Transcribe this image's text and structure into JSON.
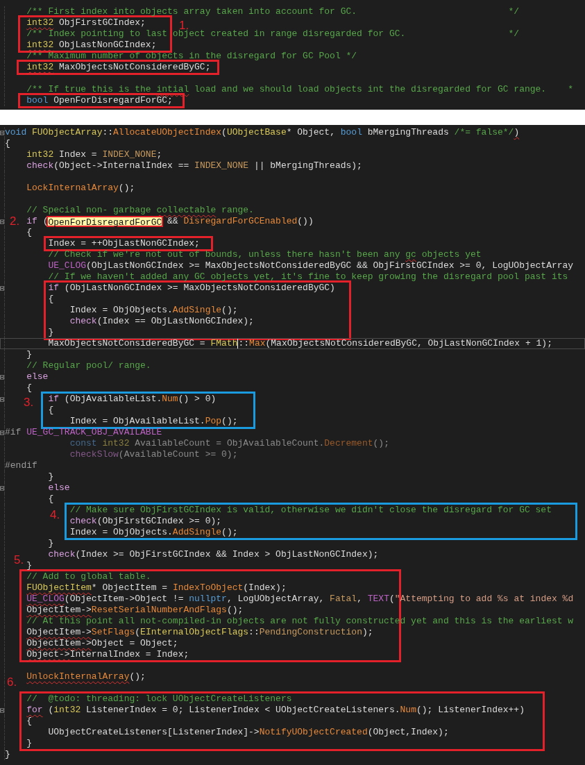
{
  "panels": [
    {
      "lines": [
        {
          "kind": "line",
          "fold": false,
          "tokens": [
            {
              "kind": "comment",
              "t": "    /** First index into objects array taken into account for GC.                            */"
            }
          ]
        },
        {
          "kind": "box",
          "color": "#e3212b",
          "label": "1.",
          "lines": [
            {
              "kind": "line",
              "fold": false,
              "tokens": [
                {
                  "kind": "type",
                  "t": "    int32",
                  "squiggle": true
                },
                {
                  "kind": "text",
                  "t": " ObjFirstGCIndex;"
                }
              ]
            },
            {
              "kind": "line",
              "fold": false,
              "tokens": [
                {
                  "kind": "comment",
                  "t": "    /** Index pointing to last object created in range disregarded for GC.                   */"
                }
              ]
            },
            {
              "kind": "line",
              "fold": false,
              "tokens": [
                {
                  "kind": "type",
                  "t": "    int32",
                  "squiggle": true
                },
                {
                  "kind": "text",
                  "t": " ObjLastNonGCIndex;"
                }
              ]
            }
          ]
        },
        {
          "kind": "line",
          "fold": false,
          "tokens": [
            {
              "kind": "comment",
              "t": "    /** Maximum number of objects in the disregard for GC Pool */"
            }
          ]
        },
        {
          "kind": "box",
          "color": "#e3212b",
          "lines": [
            {
              "kind": "line",
              "fold": false,
              "tokens": [
                {
                  "kind": "type",
                  "t": "    int32",
                  "squiggle": true
                },
                {
                  "kind": "text",
                  "t": " MaxObjectsNotConsideredByGC;"
                }
              ]
            }
          ]
        },
        {
          "kind": "line",
          "fold": false
        },
        {
          "kind": "line",
          "fold": false,
          "tokens": [
            {
              "kind": "comment",
              "t": "    /** If true this is the "
            },
            {
              "kind": "comment",
              "t": "intial",
              "squiggle": true
            },
            {
              "kind": "comment",
              "t": " load and we should load objects int the disregarded for GC range.    *"
            }
          ]
        },
        {
          "kind": "box",
          "color": "#e3212b",
          "lines": [
            {
              "kind": "line",
              "fold": false,
              "tokens": [
                {
                  "kind": "keyword",
                  "t": "    bool"
                },
                {
                  "kind": "text",
                  "t": " OpenForDisregardForGC;"
                }
              ]
            }
          ]
        }
      ]
    },
    {
      "lines": [
        {
          "kind": "line",
          "fold": true,
          "tokens": [
            {
              "kind": "keyword",
              "t": "void "
            },
            {
              "kind": "type",
              "t": "FUObjectArray"
            },
            {
              "kind": "text",
              "t": "::"
            },
            {
              "kind": "function",
              "t": "AllocateUObjectIndex"
            },
            {
              "kind": "text",
              "t": "("
            },
            {
              "kind": "type",
              "t": "UObjectBase"
            },
            {
              "kind": "text",
              "t": "* Object, "
            },
            {
              "kind": "keyword",
              "t": "bool"
            },
            {
              "kind": "text",
              "t": " bMergingThreads "
            },
            {
              "kind": "comment",
              "t": "/*= false*/"
            },
            {
              "kind": "text",
              "t": ")",
              "squiggle": true
            }
          ]
        },
        {
          "kind": "line",
          "fold": false,
          "tokens": [
            {
              "kind": "text",
              "t": "{"
            }
          ]
        },
        {
          "kind": "line",
          "fold": false,
          "tokens": [
            {
              "kind": "type",
              "t": "    int32"
            },
            {
              "kind": "text",
              "t": " Index = "
            },
            {
              "kind": "constant",
              "t": "INDEX_NONE"
            },
            {
              "kind": "text",
              "t": ";"
            }
          ]
        },
        {
          "kind": "line",
          "fold": false,
          "tokens": [
            {
              "kind": "control",
              "t": "    check"
            },
            {
              "kind": "text",
              "t": "(Object->InternalIndex == "
            },
            {
              "kind": "constant",
              "t": "INDEX_NONE"
            },
            {
              "kind": "text",
              "t": " || bMergingThreads);"
            }
          ]
        },
        {
          "kind": "line",
          "fold": false
        },
        {
          "kind": "line",
          "fold": false,
          "tokens": [
            {
              "kind": "function",
              "t": "    LockInternalArray"
            },
            {
              "kind": "text",
              "t": "();"
            }
          ]
        },
        {
          "kind": "line",
          "fold": false
        },
        {
          "kind": "line",
          "fold": false,
          "tokens": [
            {
              "kind": "comment",
              "t": "    // Special non- garbage "
            },
            {
              "kind": "comment",
              "t": "collectable",
              "squiggle": true
            },
            {
              "kind": "comment",
              "t": " range."
            }
          ]
        },
        {
          "kind": "line",
          "fold": true,
          "tokens": [
            {
              "kind": "control",
              "t": "    if"
            },
            {
              "kind": "text",
              "t": " ("
            },
            {
              "kind": "text",
              "t": "OpenForDisregardForGC",
              "highlighted": true,
              "color": "#e3212b",
              "label": "2."
            },
            {
              "kind": "text",
              "t": " && "
            },
            {
              "kind": "function",
              "t": "DisregardForGCEnabled"
            },
            {
              "kind": "text",
              "t": "())"
            }
          ]
        },
        {
          "kind": "line",
          "fold": false,
          "tokens": [
            {
              "kind": "text",
              "t": "    {"
            }
          ]
        },
        {
          "kind": "box",
          "color": "#e3212b",
          "lines": [
            {
              "kind": "line",
              "fold": false,
              "tokens": [
                {
                  "kind": "text",
                  "t": "        Index = ++ObjLastNonGCIndex;"
                }
              ]
            }
          ]
        },
        {
          "kind": "line",
          "fold": false,
          "tokens": [
            {
              "kind": "comment",
              "t": "        // Check if we're not out of bounds, unless there hasn't been any "
            },
            {
              "kind": "comment",
              "t": "gc",
              "squiggle": true
            },
            {
              "kind": "comment",
              "t": " objects yet"
            }
          ]
        },
        {
          "kind": "line",
          "fold": false,
          "tokens": [
            {
              "kind": "macro",
              "t": "        UE_CLOG"
            },
            {
              "kind": "text",
              "t": "(ObjLastNonGCIndex >= MaxObjectsNotConsideredByGC && ObjFirstGCIndex >= 0, LogUObjectArray"
            }
          ]
        },
        {
          "kind": "line",
          "fold": false,
          "tokens": [
            {
              "kind": "comment",
              "t": "        // If we haven't added any GC objects yet, it's fine to keep growing the disregard pool past its"
            }
          ]
        },
        {
          "kind": "box",
          "color": "#e3212b",
          "lines": [
            {
              "kind": "line",
              "fold": true,
              "tokens": [
                {
                  "kind": "control",
                  "t": "        if"
                },
                {
                  "kind": "text",
                  "t": " (ObjLastNonGCIndex >= MaxObjectsNotConsideredByGC)"
                }
              ]
            },
            {
              "kind": "line",
              "fold": false,
              "tokens": [
                {
                  "kind": "text",
                  "t": "        {"
                }
              ]
            },
            {
              "kind": "line",
              "fold": false,
              "tokens": [
                {
                  "kind": "text",
                  "t": "            Index = ObjObjects."
                },
                {
                  "kind": "function",
                  "t": "AddSingle"
                },
                {
                  "kind": "text",
                  "t": "();"
                }
              ]
            },
            {
              "kind": "line",
              "fold": false,
              "tokens": [
                {
                  "kind": "control",
                  "t": "            check"
                },
                {
                  "kind": "text",
                  "t": "(Index == ObjLastNonGCIndex);"
                }
              ]
            },
            {
              "kind": "line",
              "fold": false,
              "tokens": [
                {
                  "kind": "text",
                  "t": "        }"
                }
              ]
            }
          ]
        },
        {
          "kind": "line",
          "fold": false,
          "current": true,
          "tokens": [
            {
              "kind": "text",
              "t": "        MaxObjectsNotConsideredByGC = "
            },
            {
              "kind": "type",
              "t": "FMath"
            },
            {
              "kind": "text",
              "t": "::",
              "caret_before": true
            },
            {
              "kind": "function",
              "t": "Max"
            },
            {
              "kind": "text",
              "t": "(MaxObjectsNotConsideredByGC, ObjLastNonGCIndex + 1);"
            }
          ]
        },
        {
          "kind": "line",
          "fold": false,
          "tokens": [
            {
              "kind": "text",
              "t": "    }"
            }
          ]
        },
        {
          "kind": "line",
          "fold": false,
          "tokens": [
            {
              "kind": "comment",
              "t": "    // Regular pool/ range."
            }
          ]
        },
        {
          "kind": "line",
          "fold": true,
          "tokens": [
            {
              "kind": "control",
              "t": "    else"
            }
          ]
        },
        {
          "kind": "line",
          "fold": false,
          "tokens": [
            {
              "kind": "text",
              "t": "    {"
            }
          ]
        },
        {
          "kind": "box",
          "color": "#1a9be0",
          "label": "3.",
          "lines": [
            {
              "kind": "line",
              "fold": true,
              "tokens": [
                {
                  "kind": "control",
                  "t": "        if"
                },
                {
                  "kind": "text",
                  "t": " (ObjAvailableList."
                },
                {
                  "kind": "function",
                  "t": "Num"
                },
                {
                  "kind": "text",
                  "t": "() > 0)"
                }
              ]
            },
            {
              "kind": "line",
              "fold": false,
              "tokens": [
                {
                  "kind": "text",
                  "t": "        {"
                }
              ]
            },
            {
              "kind": "line",
              "fold": false,
              "tokens": [
                {
                  "kind": "text",
                  "t": "            Index = ObjAvailableList."
                },
                {
                  "kind": "function",
                  "t": "Pop"
                },
                {
                  "kind": "text",
                  "t": "();"
                }
              ]
            }
          ]
        },
        {
          "kind": "line",
          "fold": true,
          "tokens": [
            {
              "kind": "preprocessor",
              "t": "#if "
            },
            {
              "kind": "macro",
              "t": "UE_GC_TRACK_OBJ_AVAILABLE"
            }
          ]
        },
        {
          "kind": "line",
          "fold": false,
          "tokens": [
            {
              "kind": "dim_keyword",
              "t": "            const "
            },
            {
              "kind": "dim_type",
              "t": "int32"
            },
            {
              "kind": "dim_text",
              "t": " AvailableCount = ObjAvailableCount."
            },
            {
              "kind": "dim_function",
              "t": "Decrement"
            },
            {
              "kind": "dim_text",
              "t": "();"
            }
          ]
        },
        {
          "kind": "line",
          "fold": false,
          "tokens": [
            {
              "kind": "dim_control",
              "t": "            checkSlow"
            },
            {
              "kind": "dim_text",
              "t": "(AvailableCount >= 0);"
            }
          ]
        },
        {
          "kind": "line",
          "fold": false,
          "tokens": [
            {
              "kind": "preprocessor",
              "t": "#endif"
            }
          ]
        },
        {
          "kind": "line",
          "fold": false,
          "tokens": [
            {
              "kind": "text",
              "t": "        }"
            }
          ]
        },
        {
          "kind": "line",
          "fold": true,
          "tokens": [
            {
              "kind": "control",
              "t": "        else"
            }
          ]
        },
        {
          "kind": "line",
          "fold": false,
          "tokens": [
            {
              "kind": "text",
              "t": "        {"
            }
          ]
        },
        {
          "kind": "box",
          "color": "#1a9be0",
          "label": "4.",
          "lines": [
            {
              "kind": "line",
              "fold": false,
              "tokens": [
                {
                  "kind": "comment",
                  "t": "            // Make sure ObjFirstGCIndex is valid, otherwise we didn't close the disregard for GC set"
                }
              ]
            },
            {
              "kind": "line",
              "fold": false,
              "tokens": [
                {
                  "kind": "control",
                  "t": "            check"
                },
                {
                  "kind": "text",
                  "t": "(ObjFirstGCIndex >= 0);"
                }
              ]
            },
            {
              "kind": "line",
              "fold": false,
              "tokens": [
                {
                  "kind": "text",
                  "t": "            Index = ObjObjects."
                },
                {
                  "kind": "function",
                  "t": "AddSingle"
                },
                {
                  "kind": "text",
                  "t": "();"
                }
              ]
            }
          ]
        },
        {
          "kind": "line",
          "fold": false,
          "tokens": [
            {
              "kind": "text",
              "t": "        }"
            }
          ]
        },
        {
          "kind": "line",
          "fold": false,
          "tokens": [
            {
              "kind": "control",
              "t": "        check"
            },
            {
              "kind": "text",
              "t": "(Index >= ObjFirstGCIndex && Index > ObjLastNonGCIndex);"
            }
          ]
        },
        {
          "kind": "line",
          "fold": false,
          "tokens": [
            {
              "kind": "text",
              "t": "    }"
            }
          ]
        },
        {
          "kind": "box",
          "color": "#e3212b",
          "label": "5.",
          "lines": [
            {
              "kind": "line",
              "fold": false,
              "tokens": [
                {
                  "kind": "comment",
                  "t": "    // Add to global table."
                }
              ]
            },
            {
              "kind": "line",
              "fold": false,
              "tokens": [
                {
                  "kind": "type",
                  "t": "    FUObjectItem",
                  "squiggle": true
                },
                {
                  "kind": "text",
                  "t": "* ObjectItem = "
                },
                {
                  "kind": "function",
                  "t": "IndexToObject"
                },
                {
                  "kind": "text",
                  "t": "(Index);"
                }
              ]
            },
            {
              "kind": "line",
              "fold": false,
              "tokens": [
                {
                  "kind": "macro",
                  "t": "    UE_CLOG",
                  "squiggle": true
                },
                {
                  "kind": "text",
                  "t": "(ObjectItem->Object != "
                },
                {
                  "kind": "keyword",
                  "t": "nullptr"
                },
                {
                  "kind": "text",
                  "t": ", LogUObjectArray, "
                },
                {
                  "kind": "constant",
                  "t": "Fatal"
                },
                {
                  "kind": "text",
                  "t": ", "
                },
                {
                  "kind": "macro",
                  "t": "TEXT"
                },
                {
                  "kind": "text",
                  "t": "("
                },
                {
                  "kind": "string",
                  "t": "\"Attempting to add %s at index %d"
                }
              ]
            },
            {
              "kind": "line",
              "fold": false,
              "tokens": [
                {
                  "kind": "text",
                  "t": "    ObjectItem->",
                  "squiggle": true
                },
                {
                  "kind": "function",
                  "t": "ResetSerialNumberAndFlags"
                },
                {
                  "kind": "text",
                  "t": "();"
                }
              ]
            },
            {
              "kind": "line",
              "fold": false,
              "tokens": [
                {
                  "kind": "comment",
                  "t": "    // At this point all not-compiled-in objects are not fully constructed yet and this is the earliest w"
                }
              ]
            },
            {
              "kind": "line",
              "fold": false,
              "tokens": [
                {
                  "kind": "text",
                  "t": "    ObjectItem->",
                  "squiggle": true
                },
                {
                  "kind": "function",
                  "t": "SetFlags"
                },
                {
                  "kind": "text",
                  "t": "("
                },
                {
                  "kind": "type",
                  "t": "EInternalObjectFlags"
                },
                {
                  "kind": "text",
                  "t": "::"
                },
                {
                  "kind": "constant",
                  "t": "PendingConstruction"
                },
                {
                  "kind": "text",
                  "t": ");"
                }
              ]
            },
            {
              "kind": "line",
              "fold": false,
              "tokens": [
                {
                  "kind": "text",
                  "t": "    ObjectItem->",
                  "squiggle": true
                },
                {
                  "kind": "text",
                  "t": "Object = Object;"
                }
              ]
            },
            {
              "kind": "line",
              "fold": false,
              "tokens": [
                {
                  "kind": "text",
                  "t": "    Object->",
                  "squiggle": true
                },
                {
                  "kind": "text",
                  "t": "InternalIndex = Index;"
                }
              ]
            }
          ]
        },
        {
          "kind": "line",
          "fold": false
        },
        {
          "kind": "line",
          "fold": false,
          "tokens": [
            {
              "kind": "function",
              "t": "    UnlockInternalArray",
              "squiggle": true
            },
            {
              "kind": "text",
              "t": "();"
            }
          ]
        },
        {
          "kind": "line",
          "fold": false
        },
        {
          "kind": "box",
          "color": "#e3212b",
          "label": "6.",
          "lines": [
            {
              "kind": "line",
              "fold": false,
              "tokens": [
                {
                  "kind": "comment",
                  "t": "    //  @todo: threading: lock UObjectCreateListeners"
                }
              ]
            },
            {
              "kind": "line",
              "fold": true,
              "tokens": [
                {
                  "kind": "control",
                  "t": "    for",
                  "squiggle": true
                },
                {
                  "kind": "text",
                  "t": " ("
                },
                {
                  "kind": "type",
                  "t": "int32"
                },
                {
                  "kind": "text",
                  "t": " ListenerIndex = 0; ListenerIndex < UObjectCreateListeners."
                },
                {
                  "kind": "function",
                  "t": "Num"
                },
                {
                  "kind": "text",
                  "t": "(); ListenerIndex++)"
                }
              ]
            },
            {
              "kind": "line",
              "fold": false,
              "tokens": [
                {
                  "kind": "text",
                  "t": "    {"
                }
              ]
            },
            {
              "kind": "line",
              "fold": false,
              "tokens": [
                {
                  "kind": "text",
                  "t": "        UObjectCreateListeners[ListenerIndex]->"
                },
                {
                  "kind": "function",
                  "t": "NotifyUObjectCreated"
                },
                {
                  "kind": "text",
                  "t": "(Object,Index);"
                }
              ]
            },
            {
              "kind": "line",
              "fold": false,
              "tokens": [
                {
                  "kind": "text",
                  "t": "    }"
                }
              ]
            }
          ]
        },
        {
          "kind": "line",
          "fold": false,
          "tokens": [
            {
              "kind": "text",
              "t": "}"
            }
          ]
        }
      ]
    }
  ]
}
